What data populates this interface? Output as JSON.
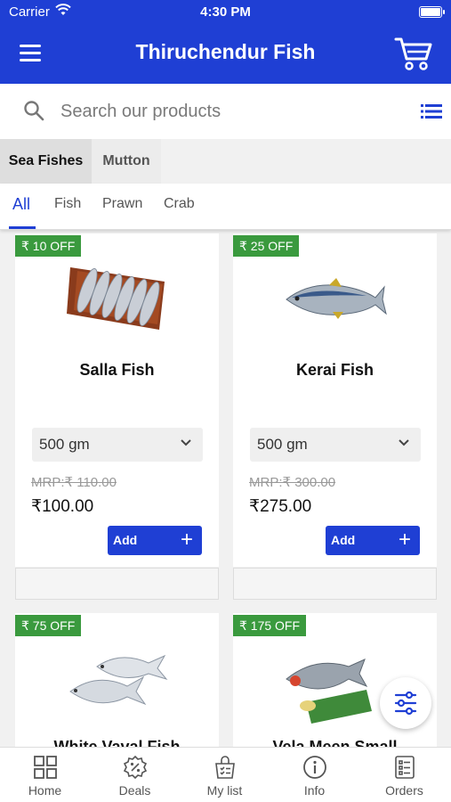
{
  "status_bar": {
    "carrier": "Carrier",
    "time": "4:30 PM"
  },
  "header": {
    "title": "Thiruchendur Fish"
  },
  "search": {
    "placeholder": "Search our products"
  },
  "categories": [
    {
      "label": "Sea Fishes",
      "active": true
    },
    {
      "label": "Mutton",
      "active": false
    }
  ],
  "subtabs": [
    {
      "label": "All",
      "active": true
    },
    {
      "label": "Fish",
      "active": false
    },
    {
      "label": "Prawn",
      "active": false
    },
    {
      "label": "Crab",
      "active": false
    }
  ],
  "products": [
    {
      "badge": "₹ 10 OFF",
      "name": "Salla Fish",
      "weight": "500 gm",
      "mrp": "MRP:₹ 110.00",
      "price": "₹100.00",
      "add_label": "Add",
      "image": "salla-fish-image"
    },
    {
      "badge": "₹ 25 OFF",
      "name": "Kerai Fish",
      "weight": "500 gm",
      "mrp": "MRP:₹ 300.00",
      "price": "₹275.00",
      "add_label": "Add",
      "image": "kerai-fish-image"
    },
    {
      "badge": "₹ 75 OFF",
      "name": "White Vaval Fish",
      "image": "white-vaval-fish-image"
    },
    {
      "badge": "₹ 175 OFF",
      "name": "Vela Meen Small",
      "image": "vela-meen-image"
    }
  ],
  "bottom_nav": [
    {
      "label": "Home",
      "icon": "grid-icon"
    },
    {
      "label": "Deals",
      "icon": "deals-badge-icon"
    },
    {
      "label": "My list",
      "icon": "shopping-list-icon"
    },
    {
      "label": "Info",
      "icon": "info-icon"
    },
    {
      "label": "Orders",
      "icon": "orders-list-icon"
    }
  ],
  "colors": {
    "primary": "#1f3fd4",
    "badge": "#3a9a3e"
  }
}
